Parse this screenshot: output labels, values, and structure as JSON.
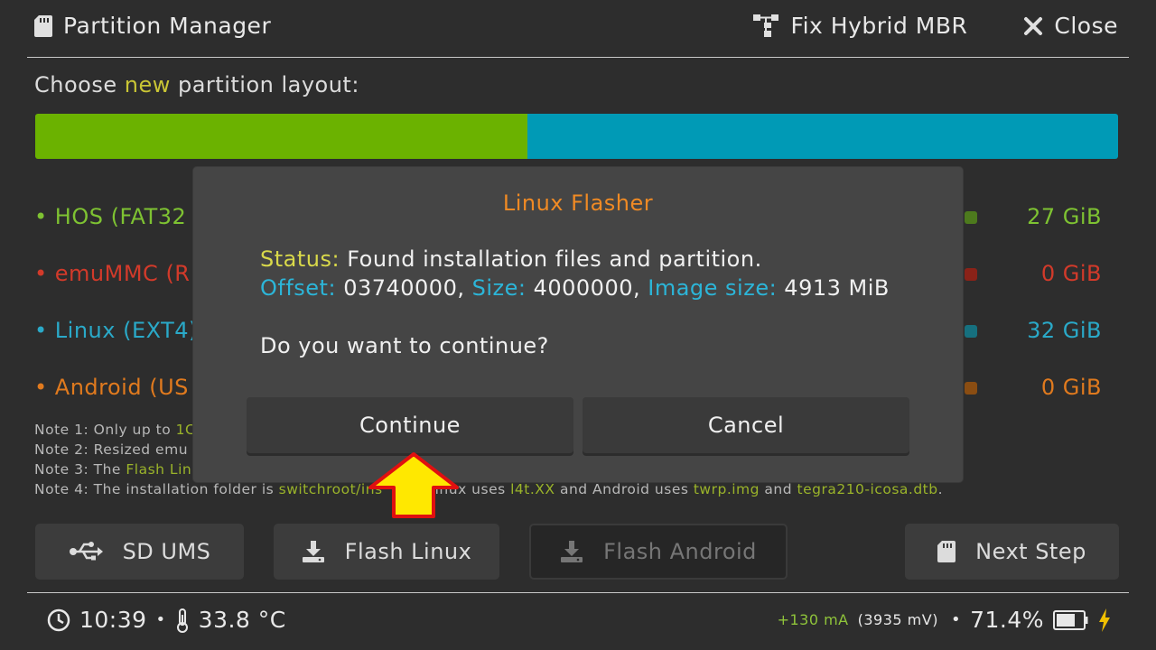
{
  "header": {
    "title": "Partition Manager",
    "title_icon": "sd-card-icon",
    "fix_mbr_label": "Fix Hybrid MBR",
    "close_label": "Close"
  },
  "choose": {
    "prefix": "Choose ",
    "accent": "new",
    "suffix": " partition layout:"
  },
  "partition_bar": {
    "segments": [
      {
        "name": "hos",
        "color": "#6bb200",
        "fraction": 0.4546
      },
      {
        "name": "linux",
        "color": "#009ab6",
        "fraction": 0.5454
      }
    ]
  },
  "partitions": [
    {
      "name": "• HOS (FAT32",
      "size": "27 GiB",
      "color": "#7ec232",
      "mini_color": "#4d7a1d"
    },
    {
      "name": "• emuMMC (R",
      "size": "0 GiB",
      "color": "#d23a2a",
      "mini_color": "#8a2218"
    },
    {
      "name": "• Linux (EXT4)",
      "size": "32 GiB",
      "color": "#2aa9c8",
      "mini_color": "#16707f"
    },
    {
      "name": "• Android (US",
      "size": "0 GiB",
      "color": "#e07a1e",
      "mini_color": "#8a4d12"
    }
  ],
  "notes": {
    "n1_prefix": "Note 1: Only up to ",
    "n1_hl": "1C",
    "n2": "Note 2: Resized emu",
    "n3_prefix": "Note 3: The ",
    "n3_hl": "Flash Lin",
    "n4_prefix": "Note 4: The installation folder is ",
    "n4_hl1": "switchroot/ins",
    "n4_mid": "inux uses ",
    "n4_hl2": "l4t.XX",
    "n4_mid2": " and Android uses ",
    "n4_hl3": "twrp.img",
    "n4_mid3": " and ",
    "n4_hl4": "tegra210-icosa.dtb",
    "n4_end": "."
  },
  "bottom_buttons": {
    "sd_ums": "SD UMS",
    "flash_linux": "Flash Linux",
    "flash_android": "Flash Android",
    "next_step": "Next Step"
  },
  "dialog": {
    "title": "Linux Flasher",
    "status_label": "Status:",
    "status_value": " Found installation files and partition.",
    "offset_label": "Offset:",
    "offset_value": " 03740000, ",
    "size_label": "Size:",
    "size_value": " 4000000, ",
    "image_size_label": "Image size:",
    "image_size_value": " 4913 MiB",
    "question": "Do you want to continue?",
    "continue_label": "Continue",
    "cancel_label": "Cancel"
  },
  "footer": {
    "time": "10:39",
    "separator": "•",
    "temperature": "33.8 °C",
    "current": "+130 mA",
    "voltage": "(3935 mV)",
    "battery_percent": "71.4%",
    "battery_level": 0.714
  },
  "colors": {
    "accent_yellow": "#c9c535",
    "dialog_title": "#f08a24",
    "info_cyan": "#2cb5d8",
    "status_yellow": "#d9d94a",
    "arrow_fill": "#ffe800",
    "arrow_stroke": "#e01010"
  }
}
